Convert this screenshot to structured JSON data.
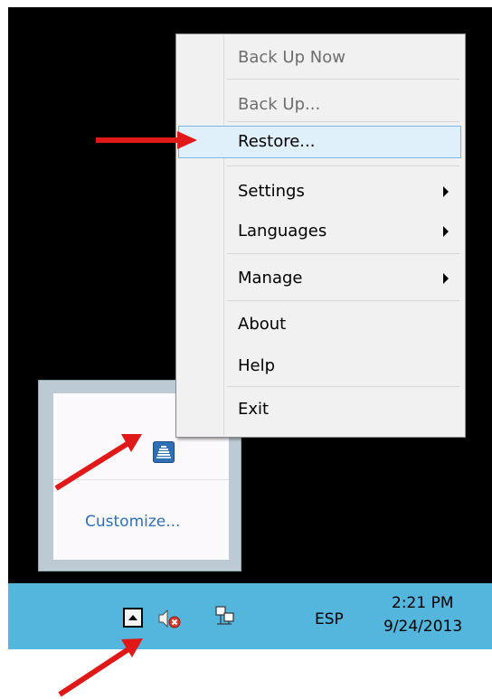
{
  "menu": {
    "items": [
      {
        "label": "Back Up Now",
        "disabled": true,
        "submenu": false
      },
      {
        "label": "Back Up...",
        "disabled": true,
        "submenu": false
      },
      {
        "label": "Restore...",
        "disabled": false,
        "submenu": false,
        "highlighted": true
      },
      {
        "label": "Settings",
        "disabled": false,
        "submenu": true
      },
      {
        "label": "Languages",
        "disabled": false,
        "submenu": true
      },
      {
        "label": "Manage",
        "disabled": false,
        "submenu": true
      },
      {
        "label": "About",
        "disabled": false,
        "submenu": false
      },
      {
        "label": "Help",
        "disabled": false,
        "submenu": false
      },
      {
        "label": "Exit",
        "disabled": false,
        "submenu": false
      }
    ]
  },
  "tray_popup": {
    "customize_label": "Customize...",
    "app_icon": "backup-app-icon"
  },
  "taskbar": {
    "overflow_icon": "chevron-up-icon",
    "speaker_icon": "speaker-muted-icon",
    "network_icon": "network-icon",
    "language": "ESP",
    "time": "2:21 PM",
    "date": "9/24/2013"
  },
  "colors": {
    "taskbar": "#54b5dd",
    "highlight": "#dff0fb",
    "annotation_arrow": "#e01818",
    "link": "#2e6fb8"
  }
}
